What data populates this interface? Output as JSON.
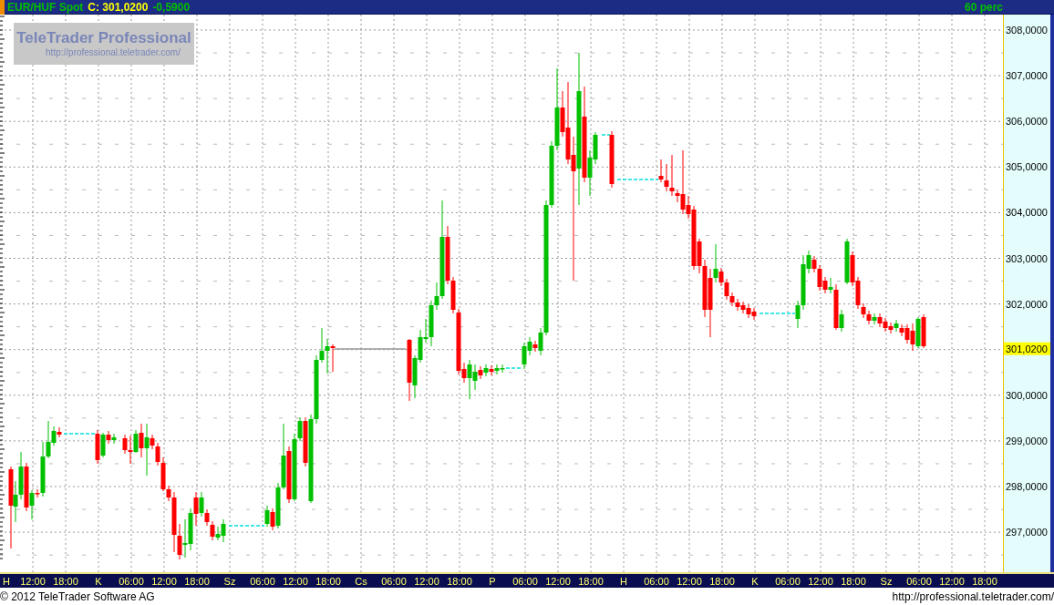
{
  "header": {
    "instrument": "EUR/HUF Spot",
    "close": "C: 301,0200",
    "change": "-0,5900",
    "interval": "60 perc"
  },
  "logo": {
    "title": "TeleTrader Professional",
    "url": "http://professional.teletrader.com/"
  },
  "y_axis": {
    "labels": [
      {
        "text": "308,0000",
        "highlighted": false
      },
      {
        "text": "307,0000",
        "highlighted": false
      },
      {
        "text": "306,0000",
        "highlighted": false
      },
      {
        "text": "305,0000",
        "highlighted": false
      },
      {
        "text": "304,0000",
        "highlighted": false
      },
      {
        "text": "303,0000",
        "highlighted": false
      },
      {
        "text": "302,0000",
        "highlighted": false
      },
      {
        "text": "301,0200",
        "highlighted": true
      },
      {
        "text": "300,0000",
        "highlighted": false
      },
      {
        "text": "299,0000",
        "highlighted": false
      },
      {
        "text": "298,0000",
        "highlighted": false
      },
      {
        "text": "297,0000",
        "highlighted": false
      }
    ]
  },
  "x_axis": {
    "labels": [
      "H",
      "12:00",
      "18:00",
      "K",
      "06:00",
      "12:00",
      "18:00",
      "Sz",
      "06:00",
      "12:00",
      "18:00",
      "Cs",
      "06:00",
      "12:00",
      "18:00",
      "P",
      "06:00",
      "12:00",
      "18:00",
      "H",
      "06:00",
      "12:00",
      "18:00",
      "K",
      "06:00",
      "12:00",
      "18:00",
      "Sz",
      "06:00",
      "12:00",
      "18:00"
    ]
  },
  "footer": {
    "copyright": "© 2012 TeleTrader Software AG",
    "url": "http://professional.teletrader.com/"
  }
}
